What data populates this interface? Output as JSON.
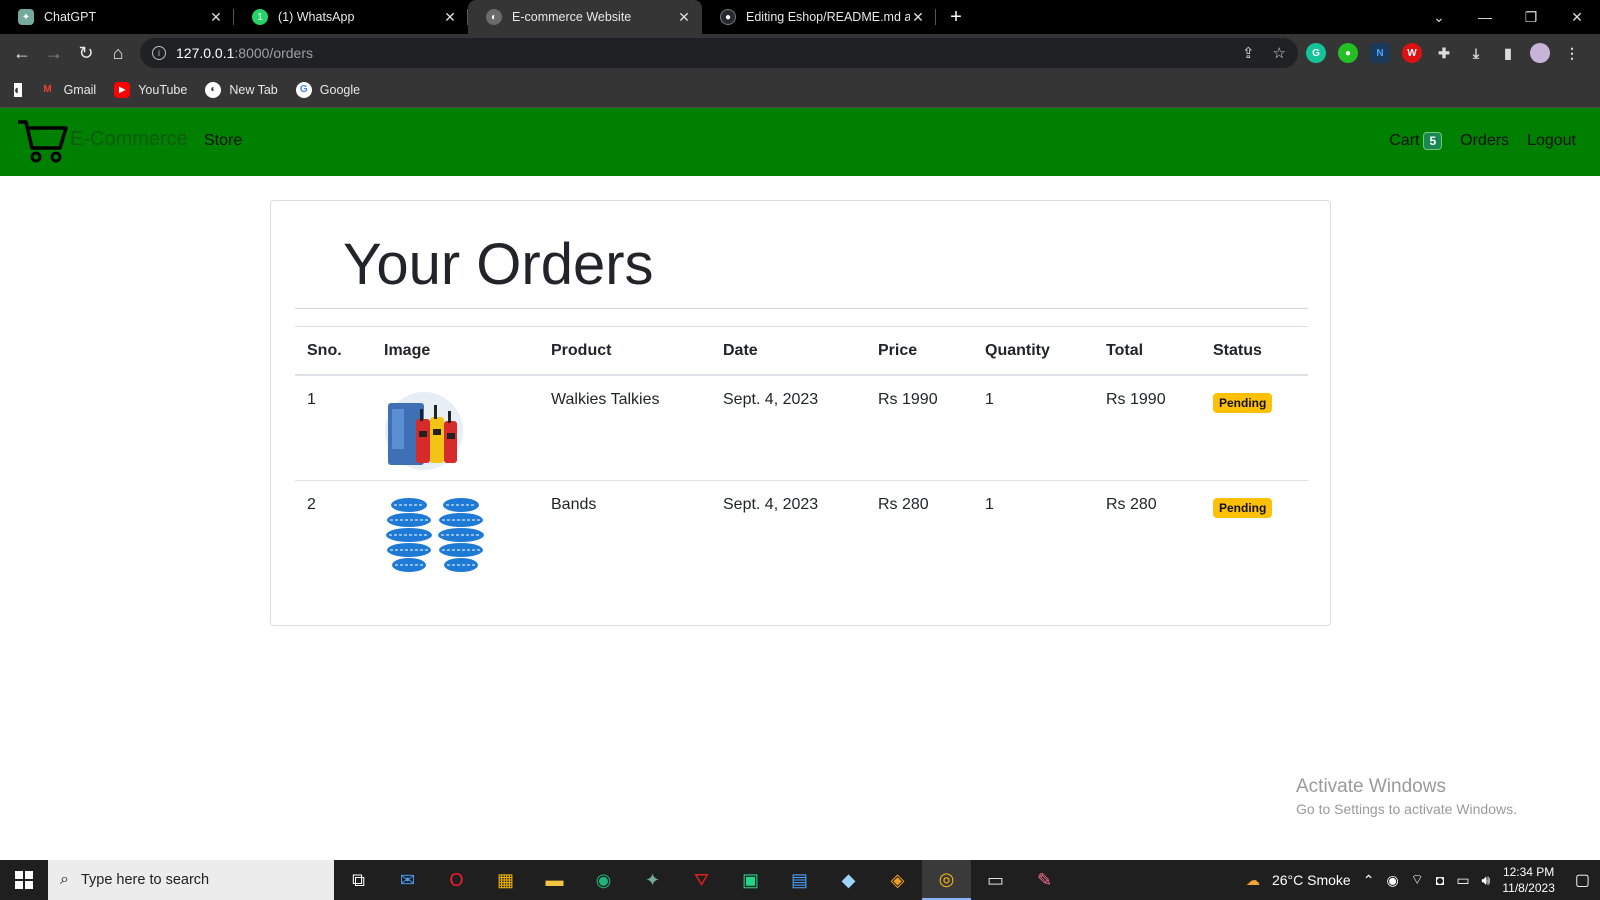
{
  "browser": {
    "tabs": [
      {
        "title": "ChatGPT",
        "icon": "chatgpt-icon",
        "color": "#74aa9c",
        "active": false
      },
      {
        "title": "(1) WhatsApp",
        "icon": "whatsapp-icon",
        "color": "#25d366",
        "active": false
      },
      {
        "title": "E-commerce Website",
        "icon": "globe-icon",
        "color": "#6b6b6b",
        "active": true
      },
      {
        "title": "Editing Eshop/README.md at m",
        "icon": "github-icon",
        "color": "#24292f",
        "active": false
      }
    ],
    "new_tab_label": "+",
    "url_host": "127.0.0.1",
    "url_path": ":8000/orders",
    "bookmarks": [
      {
        "label": "Gmail",
        "icon": "gmail-icon"
      },
      {
        "label": "YouTube",
        "icon": "youtube-icon"
      },
      {
        "label": "New Tab",
        "icon": "globe-icon"
      },
      {
        "label": "Google",
        "icon": "google-icon"
      }
    ]
  },
  "site": {
    "brand": "E-Commerce",
    "nav": {
      "store": "Store",
      "cart": "Cart",
      "cart_count": "5",
      "orders": "Orders",
      "logout": "Logout"
    },
    "accent": "#008000"
  },
  "orders": {
    "heading": "Your Orders",
    "columns": [
      "Sno.",
      "Image",
      "Product",
      "Date",
      "Price",
      "Quantity",
      "Total",
      "Status"
    ],
    "rows": [
      {
        "sno": "1",
        "image": "walkie-talkies-image",
        "product": "Walkies Talkies",
        "date": "Sept. 4, 2023",
        "price": "Rs 1990",
        "quantity": "1",
        "total": "Rs 1990",
        "status": "Pending"
      },
      {
        "sno": "2",
        "image": "bands-image",
        "product": "Bands",
        "date": "Sept. 4, 2023",
        "price": "Rs 280",
        "quantity": "1",
        "total": "Rs 280",
        "status": "Pending"
      }
    ]
  },
  "watermark": {
    "line1": "Activate Windows",
    "line2": "Go to Settings to activate Windows."
  },
  "taskbar": {
    "search_placeholder": "Type here to search",
    "weather": "26°C  Smoke",
    "time": "12:34 PM",
    "date": "11/8/2023"
  }
}
